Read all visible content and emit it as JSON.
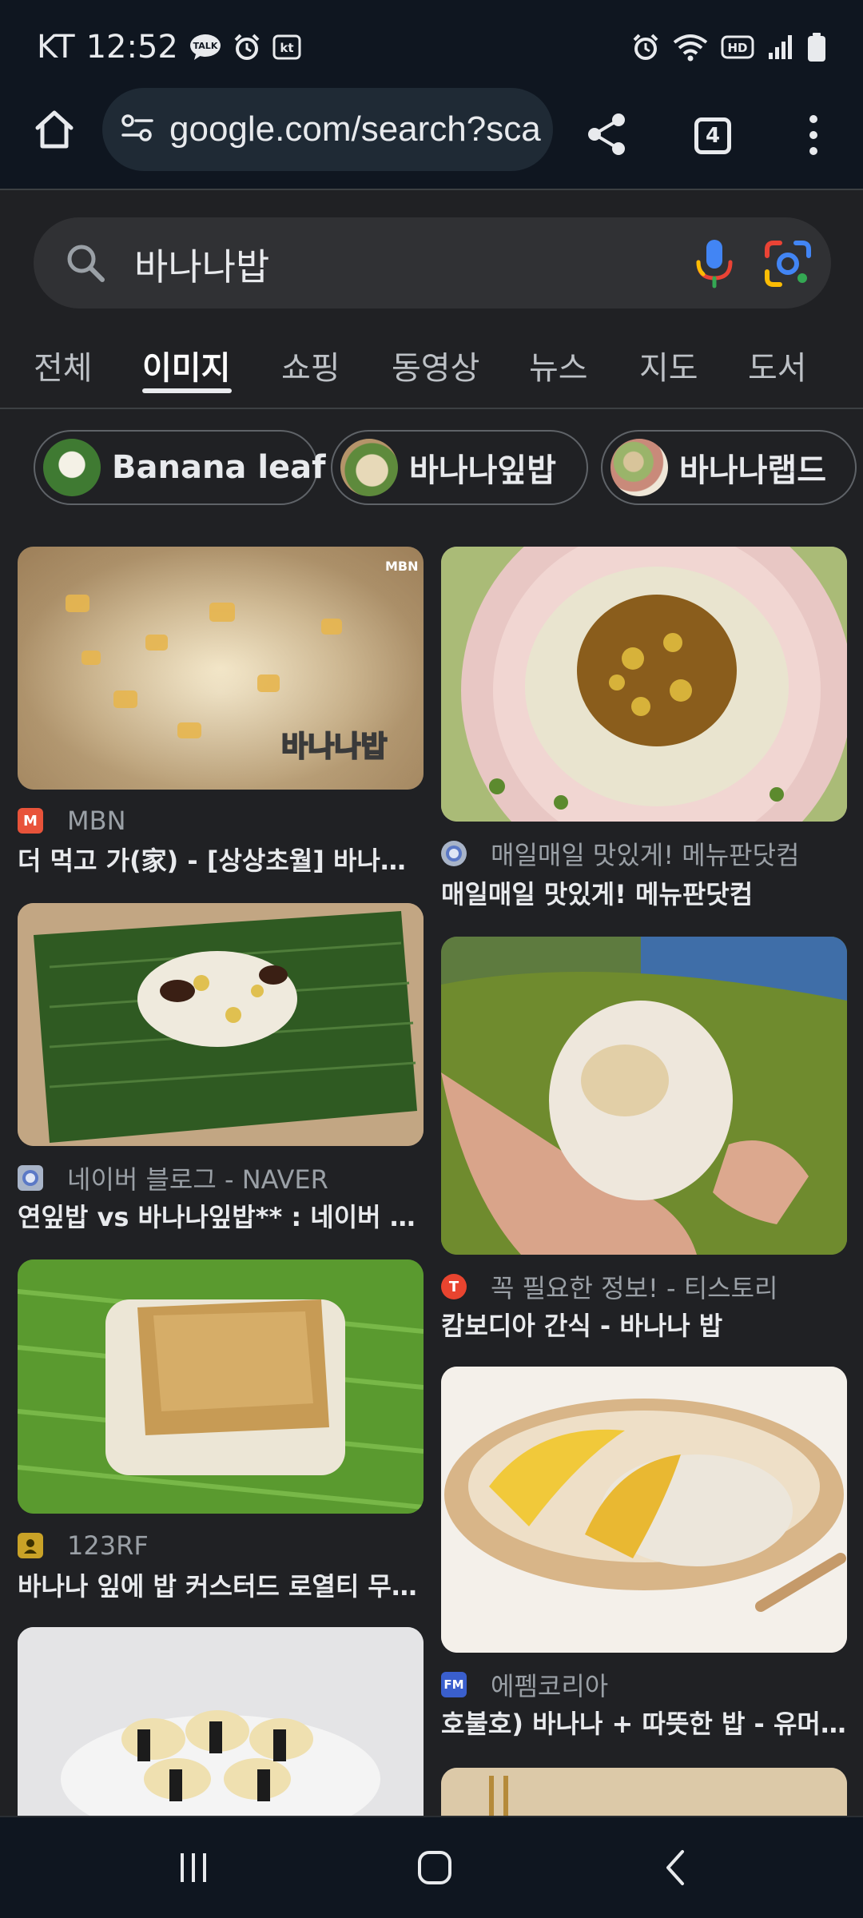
{
  "status_bar": {
    "carrier": "KT",
    "time": "12:52",
    "talk_badge": "TALK",
    "kt_badge": "kt",
    "hd_badge": "HD"
  },
  "toolbar": {
    "url": "google.com/search?sca",
    "tab_count": "4"
  },
  "search": {
    "query": "바나나밥"
  },
  "tabs": [
    {
      "label": "전체"
    },
    {
      "label": "이미지"
    },
    {
      "label": "쇼핑"
    },
    {
      "label": "동영상"
    },
    {
      "label": "뉴스"
    },
    {
      "label": "지도"
    },
    {
      "label": "도서"
    }
  ],
  "active_tab": "이미지",
  "chips": [
    {
      "label": "Banana leaf"
    },
    {
      "label": "바나나잎밥"
    },
    {
      "label": "바나나랩드"
    }
  ],
  "results": [
    {
      "source": "MBN",
      "title": "더 먹고 가(家) - [상상초월] 바나나로...",
      "icon_text": "M",
      "icon_color": "#e8533a",
      "overlay_text": "바나나밥",
      "overlay_logo": "MBN"
    },
    {
      "source": "매일매일 맛있게! 메뉴판닷컴",
      "title": "매일매일 맛있게! 메뉴판닷컴",
      "icon_text": "",
      "icon_color": "#a8b4c8"
    },
    {
      "source": "네이버 블로그 - NAVER",
      "title": "연잎밥 vs 바나나잎밥** : 네이버 블...",
      "icon_text": "",
      "icon_color": "#a8b4c8"
    },
    {
      "source": "꼭 필요한 정보! - 티스토리",
      "title": "캄보디아 간식 - 바나나 밥",
      "icon_text": "T",
      "icon_color": "#e8442f"
    },
    {
      "source": "123RF",
      "title": "바나나 잎에 밥 커스터드 로열티 무료...",
      "icon_text": "",
      "icon_color": "#c9a227"
    },
    {
      "source": "에펨코리아",
      "title": "호불호) 바나나 + 따뜻한 밥 - 유머/...",
      "icon_text": "FM",
      "icon_color": "#3a5fcd"
    }
  ]
}
